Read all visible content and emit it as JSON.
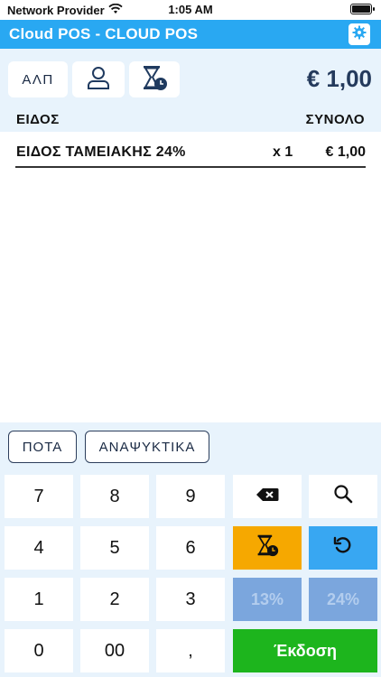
{
  "status_bar": {
    "carrier": "Network Provider",
    "time": "1:05 AM"
  },
  "title_bar": {
    "title": "Cloud POS - CLOUD POS"
  },
  "header": {
    "alp_label": "ΑΛΠ",
    "total": "€ 1,00",
    "col_item": "ΕΙΔΟΣ",
    "col_total": "ΣΥΝΟΛΟ"
  },
  "items": [
    {
      "name": "ΕΙΔΟΣ ΤΑΜΕΙΑΚΗΣ 24%",
      "qty": "x 1",
      "price": "€ 1,00"
    }
  ],
  "categories": [
    "ΠΟΤΑ",
    "ΑΝΑΨΥΚΤΙΚΑ"
  ],
  "keypad": {
    "k7": "7",
    "k8": "8",
    "k9": "9",
    "k4": "4",
    "k5": "5",
    "k6": "6",
    "k1": "1",
    "k2": "2",
    "k3": "3",
    "k0": "0",
    "k00": "00",
    "comma": ",",
    "vat13": "13%",
    "vat24": "24%",
    "issue": "Έκδοση"
  },
  "colors": {
    "accent": "#29a8f2",
    "panel_bg": "#e8f3fc",
    "orange": "#f6a800",
    "blue": "#38a7f2",
    "green": "#1db51d",
    "disabled": "#7ba6dd"
  },
  "icons": [
    "wifi-icon",
    "battery-icon",
    "settings-gear-icon",
    "user-icon",
    "hourglass-clock-icon",
    "backspace-icon",
    "search-icon",
    "undo-icon"
  ]
}
